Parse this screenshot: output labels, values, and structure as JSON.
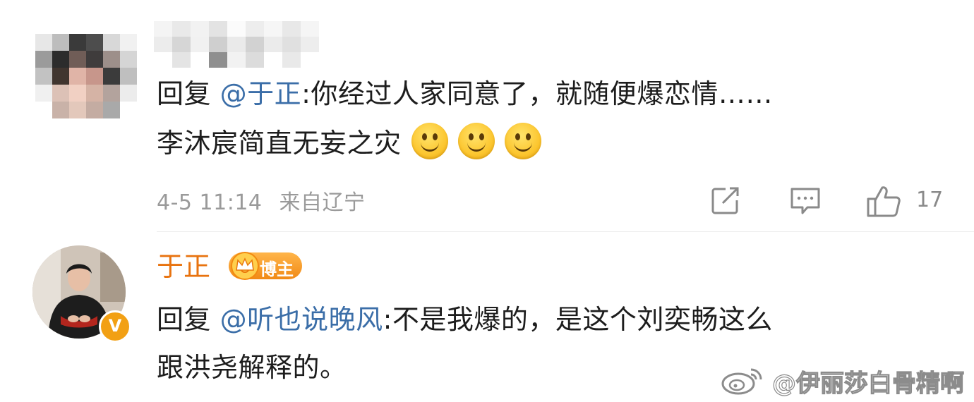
{
  "comment1": {
    "reply_prefix": "回复 ",
    "mention": "@于正",
    "line1_rest": ":你经过人家同意了，就随便爆恋情……",
    "line2": "李沐宸简直无妄之灾",
    "emoji": [
      "smile-emoji",
      "smile-emoji",
      "smile-emoji"
    ],
    "timestamp": "4-5 11:14",
    "location": "来自辽宁",
    "like_count": "17"
  },
  "comment2": {
    "author": "于正",
    "badge_label": "博主",
    "reply_prefix": "回复 ",
    "mention": "@听也说晚风",
    "line1_rest": ":不是我爆的，是这个刘奕畅这么",
    "line2": "跟洪尧解释的。",
    "verified_mark": "V"
  },
  "watermark": {
    "text": "@伊丽莎白骨精啊"
  },
  "colors": {
    "mention": "#3b6ea8",
    "author": "#e8730f",
    "meta": "#9a9a9a",
    "verified": "#f2a014"
  }
}
